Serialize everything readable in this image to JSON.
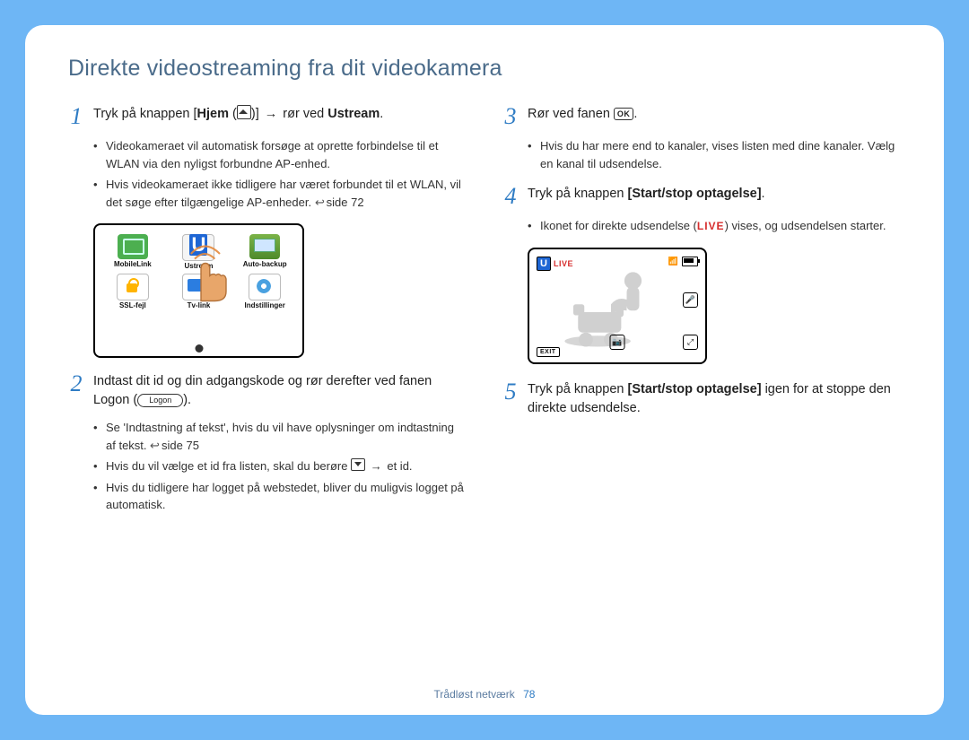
{
  "title": "Direkte videostreaming fra dit videokamera",
  "footer": {
    "section": "Trådløst netværk",
    "page": "78"
  },
  "glyphs": {
    "arrow": "→",
    "ok": "OK",
    "logon": "Logon",
    "live": "LIVE",
    "exit": "EXIT"
  },
  "grid": {
    "items": [
      {
        "id": "mobilelink",
        "label": "MobileLink"
      },
      {
        "id": "ustream",
        "label": "Ustream"
      },
      {
        "id": "autobackup",
        "label": "Auto-backup"
      },
      {
        "id": "sslfejl",
        "label": "SSL-fejl"
      },
      {
        "id": "tvlink",
        "label": "Tv-link"
      },
      {
        "id": "indstillinger",
        "label": "Indstillinger"
      }
    ]
  },
  "steps": {
    "s1": {
      "pre": "Tryk på knappen [",
      "hjem": "Hjem",
      "mid": " (",
      "post1": ")] ",
      "post2": " rør ved ",
      "target": "Ustream",
      "end": ".",
      "b1": "Videokameraet vil automatisk forsøge at oprette forbindelse til et WLAN via den nyligst forbundne AP-enhed.",
      "b2a": "Hvis videokameraet ikke tidligere har været forbundet til et WLAN, vil det søge efter tilgængelige AP-enheder. ",
      "b2ref": "side 72"
    },
    "s2": {
      "text1": "Indtast dit id og din adgangskode og rør derefter ved fanen Logon (",
      "text2": ").",
      "b1a": "Se 'Indtastning af tekst', hvis du vil have oplysninger om indtastning af tekst. ",
      "b1ref": "side 75",
      "b2a": "Hvis du vil vælge et id fra listen, skal du berøre ",
      "b2b": " et id.",
      "b3": "Hvis du tidligere har logget på webstedet, bliver du muligvis logget på automatisk."
    },
    "s3": {
      "text1": "Rør ved fanen ",
      "text2": ".",
      "b1": "Hvis du har mere end to kanaler, vises listen med dine kanaler. Vælg en kanal til udsendelse."
    },
    "s4": {
      "pre": "Tryk på knappen ",
      "btn": "[Start/stop optagelse]",
      "end": ".",
      "b1a": "Ikonet for direkte udsendelse (",
      "b1b": ") vises, og udsendelsen starter."
    },
    "s5": {
      "pre": "Tryk på knappen ",
      "btn": "[Start/stop optagelse]",
      "post": " igen for at stoppe den direkte udsendelse."
    }
  }
}
